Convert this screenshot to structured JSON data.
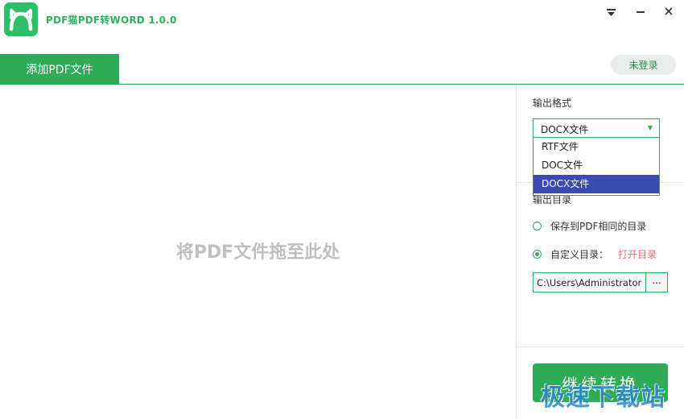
{
  "app": {
    "title": "PDF猫PDF转WORD 1.0.0"
  },
  "toolbar": {
    "add_pdf_label": "添加PDF文件",
    "login_label": "未登录"
  },
  "main": {
    "drop_hint": "将PDF文件拖至此处"
  },
  "panel": {
    "format_label": "输出格式",
    "format_selected": "DOCX文件",
    "format_options": [
      "RTF文件",
      "DOC文件",
      "DOCX文件"
    ],
    "dir_label": "输出目录",
    "radio_same_dir": "保存到PDF相同的目录",
    "radio_custom_dir": "自定义目录：",
    "open_dir_link": "打开目录",
    "path_value": "C:\\Users\\Administrator",
    "browse_label": "...",
    "convert_label": "继续转换"
  },
  "watermark": {
    "text": "极速下载站"
  },
  "colors": {
    "accent": "#2fac57",
    "selection": "#3c4bb2",
    "link": "#e96b6b"
  },
  "icons": {
    "logo": "pdf-cat-logo-icon",
    "menu": "menu-icon",
    "minimize": "minimize-icon",
    "close": "close-icon"
  }
}
